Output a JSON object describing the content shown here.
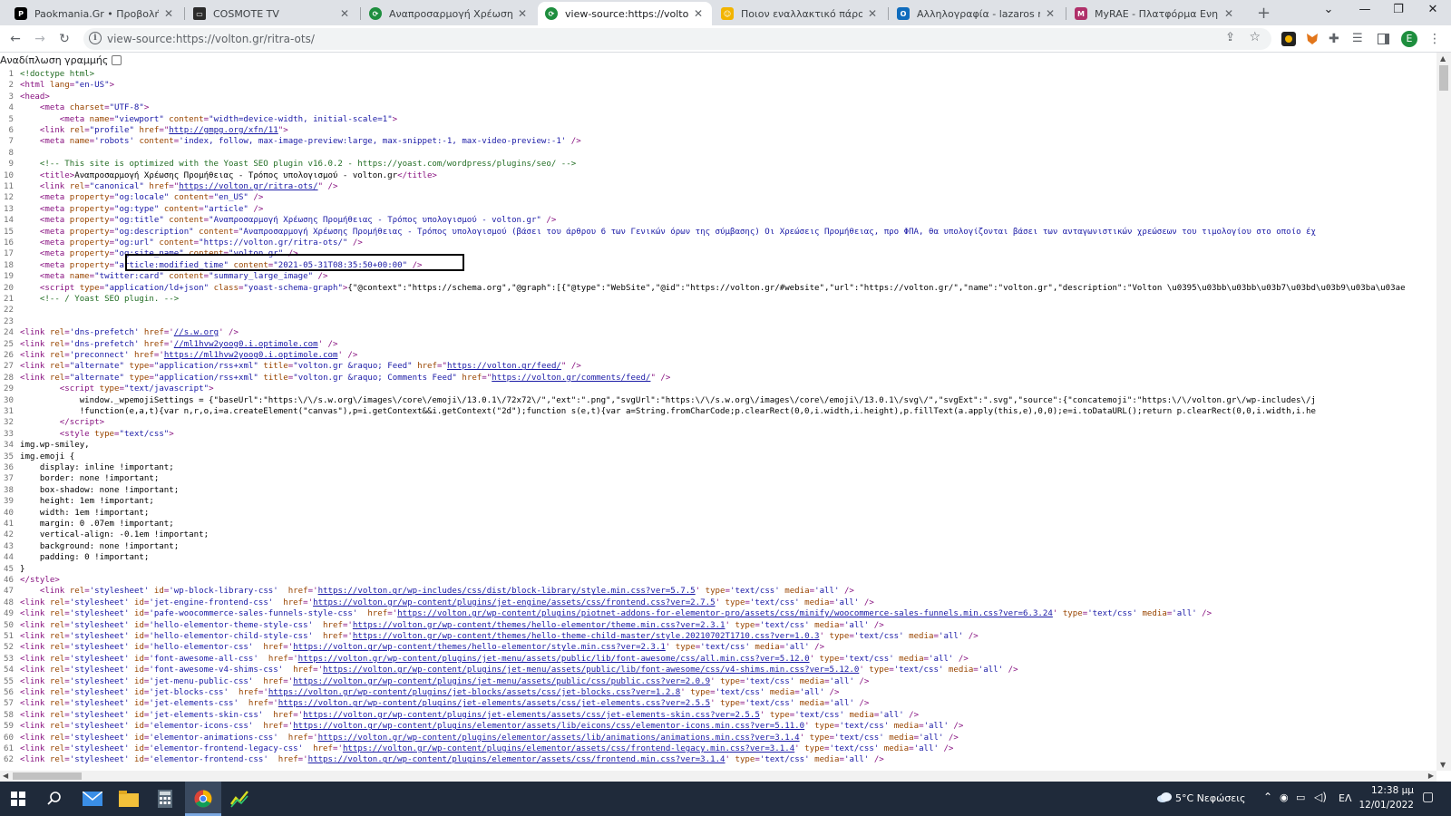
{
  "tabs": [
    {
      "label": "Paokmania.Gr • Προβολή θέματ",
      "favicon": "paokmania-favicon",
      "active": false
    },
    {
      "label": "COSMOTE TV",
      "favicon": "cosmote-tv-favicon",
      "active": false
    },
    {
      "label": "Αναπροσαρμογή Χρέωσης Προ",
      "favicon": "volton-favicon",
      "active": false
    },
    {
      "label": "view-source:https://volton.gr/rit",
      "favicon": "volton-favicon",
      "active": true
    },
    {
      "label": "Ποιον εναλλακτικό πάροχο αν",
      "favicon": "forum-favicon",
      "active": false
    },
    {
      "label": "Αλληλογραφία - lazaros makrid",
      "favicon": "outlook-favicon",
      "active": false
    },
    {
      "label": "MyRAE - Πλατφόρμα Ενημέρω",
      "favicon": "myrae-favicon",
      "active": false
    }
  ],
  "address_bar": {
    "url": "view-source:https://volton.gr/ritra-ots/"
  },
  "profile_initial": "E",
  "wrap_toggle_label": "Αναδίπλωση γραμμής",
  "source_lines": [
    {
      "n": "1",
      "html": "<span class=\"c\">&lt;!doctype html&gt;</span>"
    },
    {
      "n": "2",
      "html": "&lt;html <span class=\"a\">lang</span>=<span class=\"v\">\"en-US\"</span>&gt;"
    },
    {
      "n": "3",
      "html": "&lt;head&gt;"
    },
    {
      "n": "4",
      "html": "    &lt;meta <span class=\"a\">charset</span>=<span class=\"v\">\"UTF-8\"</span>&gt;"
    },
    {
      "n": "5",
      "html": "        &lt;meta <span class=\"a\">name</span>=<span class=\"v\">\"viewport\"</span> <span class=\"a\">content</span>=<span class=\"v\">\"width=device-width, initial-scale=1\"</span>&gt;"
    },
    {
      "n": "6",
      "html": "    &lt;link <span class=\"a\">rel</span>=<span class=\"v\">\"profile\"</span> <span class=\"a\">href</span>=\"<span class=\"u\">http://gmpg.org/xfn/11</span>\"&gt;"
    },
    {
      "n": "7",
      "html": "    &lt;meta <span class=\"a\">name</span>=<span class=\"v\">'robots'</span> <span class=\"a\">content</span>=<span class=\"v\">'index, follow, max-image-preview:large, max-snippet:-1, max-video-preview:-1'</span> /&gt;"
    },
    {
      "n": "8",
      "html": ""
    },
    {
      "n": "9",
      "html": "    <span class=\"c\">&lt;!-- This site is optimized with the Yoast SEO plugin v16.0.2 - https://yoast.com/wordpress/plugins/seo/ --&gt;</span>"
    },
    {
      "n": "10",
      "html": "    &lt;title&gt;<span class=\"s\">Αναπροσαρμογή Χρέωσης Προμήθειας - Τρόπος υπολογισμού - volton.gr</span>&lt;/title&gt;"
    },
    {
      "n": "11",
      "html": "    &lt;link <span class=\"a\">rel</span>=<span class=\"v\">\"canonical\"</span> <span class=\"a\">href</span>=\"<span class=\"u\">https://volton.gr/ritra-ots/</span>\" /&gt;"
    },
    {
      "n": "12",
      "html": "    &lt;meta <span class=\"a\">property</span>=<span class=\"v\">\"og:locale\"</span> <span class=\"a\">content</span>=<span class=\"v\">\"en_US\"</span> /&gt;"
    },
    {
      "n": "13",
      "html": "    &lt;meta <span class=\"a\">property</span>=<span class=\"v\">\"og:type\"</span> <span class=\"a\">content</span>=<span class=\"v\">\"article\"</span> /&gt;"
    },
    {
      "n": "14",
      "html": "    &lt;meta <span class=\"a\">property</span>=<span class=\"v\">\"og:title\"</span> <span class=\"a\">content</span>=<span class=\"v\">\"Αναπροσαρμογή Χρέωσης Προμήθειας - Τρόπος υπολογισμού - volton.gr\"</span> /&gt;"
    },
    {
      "n": "15",
      "html": "    &lt;meta <span class=\"a\">property</span>=<span class=\"v\">\"og:description\"</span> <span class=\"a\">content</span>=<span class=\"v\">\"Αναπροσαρμογή Χρέωσης Προμήθειας - Τρόπος υπολογισμού (βάσει του άρθρου 6 των Γενικών όρων της σύμβασης) Οι Χρεώσεις Προμήθειας, προ ΦΠΑ, θα υπολογίζονται βάσει των ανταγωνιστικών χρεώσεων του τιμολογίου στο οποίο έχ</span>"
    },
    {
      "n": "16",
      "html": "    &lt;meta <span class=\"a\">property</span>=<span class=\"v\">\"og:url\"</span> <span class=\"a\">content</span>=<span class=\"v\">\"https://volton.gr/ritra-ots/\"</span> /&gt;"
    },
    {
      "n": "17",
      "html": "    &lt;meta <span class=\"a\">property</span>=<span class=\"v\">\"og:site_name\"</span> <span class=\"a\">content</span>=<span class=\"v\">\"volton.gr\"</span> /&gt;"
    },
    {
      "n": "18",
      "html": "    &lt;meta <span class=\"a\">property</span>=<span class=\"v\">\"article:modified_time\"</span> <span class=\"a\">content</span>=<span class=\"v\">\"2021-05-31T08:35:50+00:00\"</span> /&gt;"
    },
    {
      "n": "19",
      "html": "    &lt;meta <span class=\"a\">name</span>=<span class=\"v\">\"twitter:card\"</span> <span class=\"a\">content</span>=<span class=\"v\">\"summary_large_image\"</span> /&gt;"
    },
    {
      "n": "20",
      "html": "    &lt;script <span class=\"a\">type</span>=<span class=\"v\">\"application/ld+json\"</span> <span class=\"a\">class</span>=<span class=\"v\">\"yoast-schema-graph\"</span>&gt;<span class=\"s\">{\"@context\":\"https://schema.org\",\"@graph\":[{\"@type\":\"WebSite\",\"@id\":\"https://volton.gr/#website\",\"url\":\"https://volton.gr/\",\"name\":\"volton.gr\",\"description\":\"Volton \\u0395\\u03bb\\u03bb\\u03b7\\u03bd\\u03b9\\u03ba\\u03ae</span>"
    },
    {
      "n": "21",
      "html": "    <span class=\"c\">&lt;!-- / Yoast SEO plugin. --&gt;</span>"
    },
    {
      "n": "22",
      "html": ""
    },
    {
      "n": "23",
      "html": ""
    },
    {
      "n": "24",
      "html": "&lt;link <span class=\"a\">rel</span>=<span class=\"v\">'dns-prefetch'</span> <span class=\"a\">href</span>='<span class=\"u\">//s.w.org</span>' /&gt;"
    },
    {
      "n": "25",
      "html": "&lt;link <span class=\"a\">rel</span>=<span class=\"v\">'dns-prefetch'</span> <span class=\"a\">href</span>='<span class=\"u\">//ml1hvw2yoog0.i.optimole.com</span>' /&gt;"
    },
    {
      "n": "26",
      "html": "&lt;link <span class=\"a\">rel</span>=<span class=\"v\">'preconnect'</span> <span class=\"a\">href</span>='<span class=\"u\">https://ml1hvw2yoog0.i.optimole.com</span>' /&gt;"
    },
    {
      "n": "27",
      "html": "&lt;link <span class=\"a\">rel</span>=<span class=\"v\">\"alternate\"</span> <span class=\"a\">type</span>=<span class=\"v\">\"application/rss+xml\"</span> <span class=\"a\">title</span>=<span class=\"v\">\"volton.gr &amp;raquo; Feed\"</span> <span class=\"a\">href</span>=\"<span class=\"u\">https://volton.gr/feed/</span>\" /&gt;"
    },
    {
      "n": "28",
      "html": "&lt;link <span class=\"a\">rel</span>=<span class=\"v\">\"alternate\"</span> <span class=\"a\">type</span>=<span class=\"v\">\"application/rss+xml\"</span> <span class=\"a\">title</span>=<span class=\"v\">\"volton.gr &amp;raquo; Comments Feed\"</span> <span class=\"a\">href</span>=\"<span class=\"u\">https://volton.gr/comments/feed/</span>\" /&gt;"
    },
    {
      "n": "29",
      "html": "        &lt;script <span class=\"a\">type</span>=<span class=\"v\">\"text/javascript\"</span>&gt;"
    },
    {
      "n": "30",
      "html": "<span class=\"s\">            window._wpemojiSettings = {\"baseUrl\":\"https:\\/\\/s.w.org\\/images\\/core\\/emoji\\/13.0.1\\/72x72\\/\",\"ext\":\".png\",\"svgUrl\":\"https:\\/\\/s.w.org\\/images\\/core\\/emoji\\/13.0.1\\/svg\\/\",\"svgExt\":\".svg\",\"source\":{\"concatemoji\":\"https:\\/\\/volton.gr\\/wp-includes\\/j</span>"
    },
    {
      "n": "31",
      "html": "<span class=\"s\">            !function(e,a,t){var n,r,o,i=a.createElement(\"canvas\"),p=i.getContext&amp;&amp;i.getContext(\"2d\");function s(e,t){var a=String.fromCharCode;p.clearRect(0,0,i.width,i.height),p.fillText(a.apply(this,e),0,0);e=i.toDataURL();return p.clearRect(0,0,i.width,i.he</span>"
    },
    {
      "n": "32",
      "html": "        &lt;/script&gt;"
    },
    {
      "n": "33",
      "html": "        &lt;style <span class=\"a\">type</span>=<span class=\"v\">\"text/css\"</span>&gt;"
    },
    {
      "n": "34",
      "html": "<span class=\"s\">img.wp-smiley,</span>"
    },
    {
      "n": "35",
      "html": "<span class=\"s\">img.emoji {</span>"
    },
    {
      "n": "36",
      "html": "<span class=\"s\">    display: inline !important;</span>"
    },
    {
      "n": "37",
      "html": "<span class=\"s\">    border: none !important;</span>"
    },
    {
      "n": "38",
      "html": "<span class=\"s\">    box-shadow: none !important;</span>"
    },
    {
      "n": "39",
      "html": "<span class=\"s\">    height: 1em !important;</span>"
    },
    {
      "n": "40",
      "html": "<span class=\"s\">    width: 1em !important;</span>"
    },
    {
      "n": "41",
      "html": "<span class=\"s\">    margin: 0 .07em !important;</span>"
    },
    {
      "n": "42",
      "html": "<span class=\"s\">    vertical-align: -0.1em !important;</span>"
    },
    {
      "n": "43",
      "html": "<span class=\"s\">    background: none !important;</span>"
    },
    {
      "n": "44",
      "html": "<span class=\"s\">    padding: 0 !important;</span>"
    },
    {
      "n": "45",
      "html": "<span class=\"s\">}</span>"
    },
    {
      "n": "46",
      "html": "&lt;/style&gt;"
    },
    {
      "n": "47",
      "html": "    &lt;link <span class=\"a\">rel</span>=<span class=\"v\">'stylesheet'</span> <span class=\"a\">id</span>=<span class=\"v\">'wp-block-library-css'</span>  <span class=\"a\">href</span>='<span class=\"u\">https://volton.gr/wp-includes/css/dist/block-library/style.min.css?ver=5.7.5</span>' <span class=\"a\">type</span>=<span class=\"v\">'text/css'</span> <span class=\"a\">media</span>=<span class=\"v\">'all'</span> /&gt;"
    },
    {
      "n": "48",
      "html": "&lt;link <span class=\"a\">rel</span>=<span class=\"v\">'stylesheet'</span> <span class=\"a\">id</span>=<span class=\"v\">'jet-engine-frontend-css'</span>  <span class=\"a\">href</span>='<span class=\"u\">https://volton.gr/wp-content/plugins/jet-engine/assets/css/frontend.css?ver=2.7.5</span>' <span class=\"a\">type</span>=<span class=\"v\">'text/css'</span> <span class=\"a\">media</span>=<span class=\"v\">'all'</span> /&gt;"
    },
    {
      "n": "49",
      "html": "&lt;link <span class=\"a\">rel</span>=<span class=\"v\">'stylesheet'</span> <span class=\"a\">id</span>=<span class=\"v\">'pafe-woocommerce-sales-funnels-style-css'</span>  <span class=\"a\">href</span>='<span class=\"u\">https://volton.gr/wp-content/plugins/piotnet-addons-for-elementor-pro/assets/css/minify/woocommerce-sales-funnels.min.css?ver=6.3.24</span>' <span class=\"a\">type</span>=<span class=\"v\">'text/css'</span> <span class=\"a\">media</span>=<span class=\"v\">'all'</span> /&gt;"
    },
    {
      "n": "50",
      "html": "&lt;link <span class=\"a\">rel</span>=<span class=\"v\">'stylesheet'</span> <span class=\"a\">id</span>=<span class=\"v\">'hello-elementor-theme-style-css'</span>  <span class=\"a\">href</span>='<span class=\"u\">https://volton.gr/wp-content/themes/hello-elementor/theme.min.css?ver=2.3.1</span>' <span class=\"a\">type</span>=<span class=\"v\">'text/css'</span> <span class=\"a\">media</span>=<span class=\"v\">'all'</span> /&gt;"
    },
    {
      "n": "51",
      "html": "&lt;link <span class=\"a\">rel</span>=<span class=\"v\">'stylesheet'</span> <span class=\"a\">id</span>=<span class=\"v\">'hello-elementor-child-style-css'</span>  <span class=\"a\">href</span>='<span class=\"u\">https://volton.gr/wp-content/themes/hello-theme-child-master/style.20210702T1710.css?ver=1.0.3</span>' <span class=\"a\">type</span>=<span class=\"v\">'text/css'</span> <span class=\"a\">media</span>=<span class=\"v\">'all'</span> /&gt;"
    },
    {
      "n": "52",
      "html": "&lt;link <span class=\"a\">rel</span>=<span class=\"v\">'stylesheet'</span> <span class=\"a\">id</span>=<span class=\"v\">'hello-elementor-css'</span>  <span class=\"a\">href</span>='<span class=\"u\">https://volton.gr/wp-content/themes/hello-elementor/style.min.css?ver=2.3.1</span>' <span class=\"a\">type</span>=<span class=\"v\">'text/css'</span> <span class=\"a\">media</span>=<span class=\"v\">'all'</span> /&gt;"
    },
    {
      "n": "53",
      "html": "&lt;link <span class=\"a\">rel</span>=<span class=\"v\">'stylesheet'</span> <span class=\"a\">id</span>=<span class=\"v\">'font-awesome-all-css'</span>  <span class=\"a\">href</span>='<span class=\"u\">https://volton.gr/wp-content/plugins/jet-menu/assets/public/lib/font-awesome/css/all.min.css?ver=5.12.0</span>' <span class=\"a\">type</span>=<span class=\"v\">'text/css'</span> <span class=\"a\">media</span>=<span class=\"v\">'all'</span> /&gt;"
    },
    {
      "n": "54",
      "html": "&lt;link <span class=\"a\">rel</span>=<span class=\"v\">'stylesheet'</span> <span class=\"a\">id</span>=<span class=\"v\">'font-awesome-v4-shims-css'</span>  <span class=\"a\">href</span>='<span class=\"u\">https://volton.gr/wp-content/plugins/jet-menu/assets/public/lib/font-awesome/css/v4-shims.min.css?ver=5.12.0</span>' <span class=\"a\">type</span>=<span class=\"v\">'text/css'</span> <span class=\"a\">media</span>=<span class=\"v\">'all'</span> /&gt;"
    },
    {
      "n": "55",
      "html": "&lt;link <span class=\"a\">rel</span>=<span class=\"v\">'stylesheet'</span> <span class=\"a\">id</span>=<span class=\"v\">'jet-menu-public-css'</span>  <span class=\"a\">href</span>='<span class=\"u\">https://volton.gr/wp-content/plugins/jet-menu/assets/public/css/public.css?ver=2.0.9</span>' <span class=\"a\">type</span>=<span class=\"v\">'text/css'</span> <span class=\"a\">media</span>=<span class=\"v\">'all'</span> /&gt;"
    },
    {
      "n": "56",
      "html": "&lt;link <span class=\"a\">rel</span>=<span class=\"v\">'stylesheet'</span> <span class=\"a\">id</span>=<span class=\"v\">'jet-blocks-css'</span>  <span class=\"a\">href</span>='<span class=\"u\">https://volton.gr/wp-content/plugins/jet-blocks/assets/css/jet-blocks.css?ver=1.2.8</span>' <span class=\"a\">type</span>=<span class=\"v\">'text/css'</span> <span class=\"a\">media</span>=<span class=\"v\">'all'</span> /&gt;"
    },
    {
      "n": "57",
      "html": "&lt;link <span class=\"a\">rel</span>=<span class=\"v\">'stylesheet'</span> <span class=\"a\">id</span>=<span class=\"v\">'jet-elements-css'</span>  <span class=\"a\">href</span>='<span class=\"u\">https://volton.gr/wp-content/plugins/jet-elements/assets/css/jet-elements.css?ver=2.5.5</span>' <span class=\"a\">type</span>=<span class=\"v\">'text/css'</span> <span class=\"a\">media</span>=<span class=\"v\">'all'</span> /&gt;"
    },
    {
      "n": "58",
      "html": "&lt;link <span class=\"a\">rel</span>=<span class=\"v\">'stylesheet'</span> <span class=\"a\">id</span>=<span class=\"v\">'jet-elements-skin-css'</span>  <span class=\"a\">href</span>='<span class=\"u\">https://volton.gr/wp-content/plugins/jet-elements/assets/css/jet-elements-skin.css?ver=2.5.5</span>' <span class=\"a\">type</span>=<span class=\"v\">'text/css'</span> <span class=\"a\">media</span>=<span class=\"v\">'all'</span> /&gt;"
    },
    {
      "n": "59",
      "html": "&lt;link <span class=\"a\">rel</span>=<span class=\"v\">'stylesheet'</span> <span class=\"a\">id</span>=<span class=\"v\">'elementor-icons-css'</span>  <span class=\"a\">href</span>='<span class=\"u\">https://volton.gr/wp-content/plugins/elementor/assets/lib/eicons/css/elementor-icons.min.css?ver=5.11.0</span>' <span class=\"a\">type</span>=<span class=\"v\">'text/css'</span> <span class=\"a\">media</span>=<span class=\"v\">'all'</span> /&gt;"
    },
    {
      "n": "60",
      "html": "&lt;link <span class=\"a\">rel</span>=<span class=\"v\">'stylesheet'</span> <span class=\"a\">id</span>=<span class=\"v\">'elementor-animations-css'</span>  <span class=\"a\">href</span>='<span class=\"u\">https://volton.gr/wp-content/plugins/elementor/assets/lib/animations/animations.min.css?ver=3.1.4</span>' <span class=\"a\">type</span>=<span class=\"v\">'text/css'</span> <span class=\"a\">media</span>=<span class=\"v\">'all'</span> /&gt;"
    },
    {
      "n": "61",
      "html": "&lt;link <span class=\"a\">rel</span>=<span class=\"v\">'stylesheet'</span> <span class=\"a\">id</span>=<span class=\"v\">'elementor-frontend-legacy-css'</span>  <span class=\"a\">href</span>='<span class=\"u\">https://volton.gr/wp-content/plugins/elementor/assets/css/frontend-legacy.min.css?ver=3.1.4</span>' <span class=\"a\">type</span>=<span class=\"v\">'text/css'</span> <span class=\"a\">media</span>=<span class=\"v\">'all'</span> /&gt;"
    },
    {
      "n": "62",
      "html": "&lt;link <span class=\"a\">rel</span>=<span class=\"v\">'stylesheet'</span> <span class=\"a\">id</span>=<span class=\"v\">'elementor-frontend-css'</span>  <span class=\"a\">href</span>='<span class=\"u\">https://volton.gr/wp-content/plugins/elementor/assets/css/frontend.min.css?ver=3.1.4</span>' <span class=\"a\">type</span>=<span class=\"v\">'text/css'</span> <span class=\"a\">media</span>=<span class=\"v\">'all'</span> /&gt;"
    }
  ],
  "taskbar": {
    "weather": "5°C Νεφώσεις",
    "language": "ΕΛ",
    "time": "12:38 μμ",
    "date": "12/01/2022"
  },
  "colors": {
    "tag": "#881280",
    "attr_name": "#994500",
    "attr_value": "#1a1aa6",
    "comment": "#236e25",
    "line_number": "#737373",
    "taskbar": "#1f2a3a"
  }
}
